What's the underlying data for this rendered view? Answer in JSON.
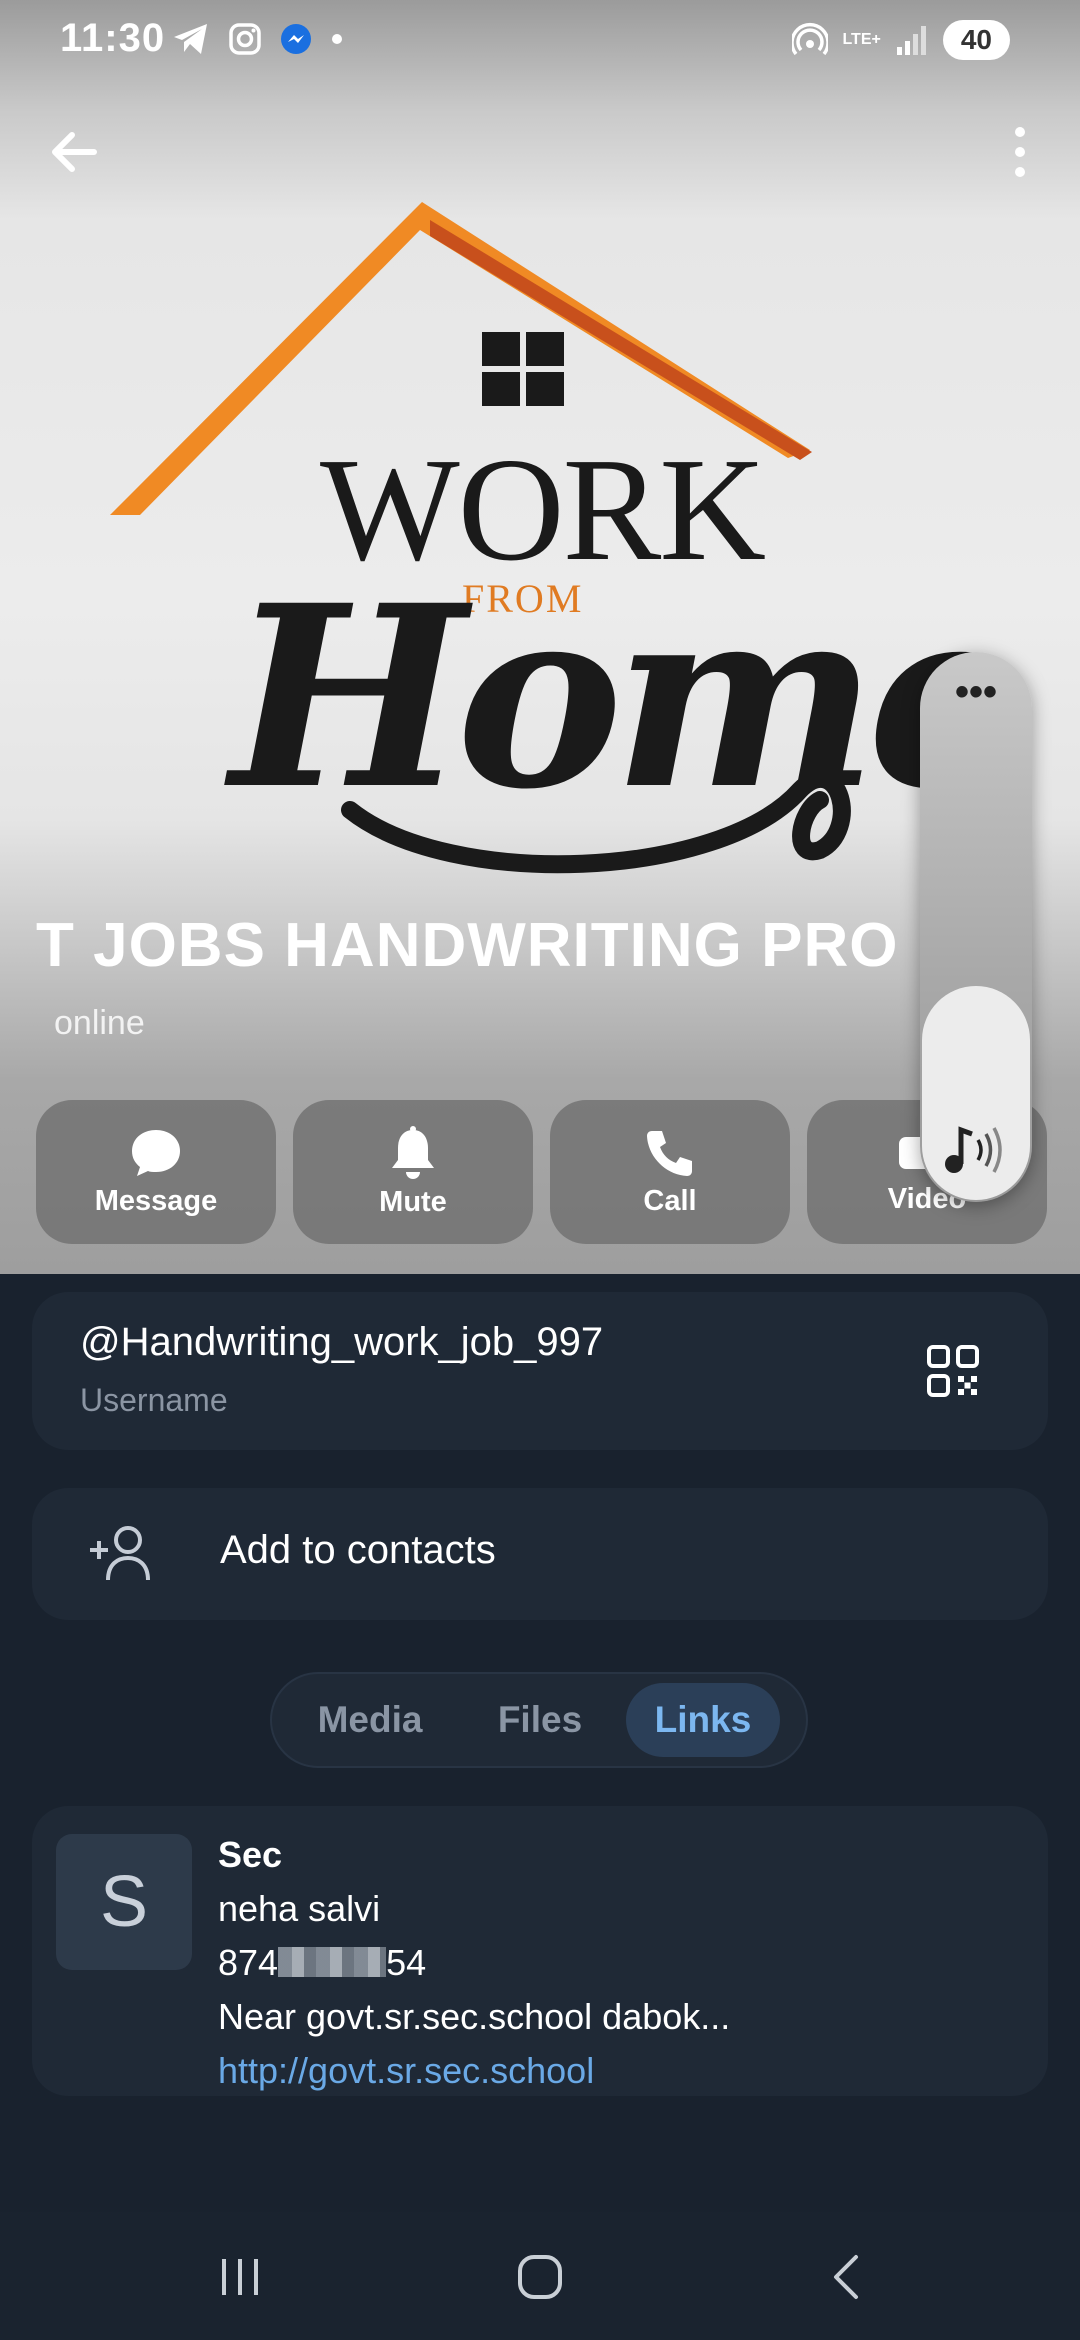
{
  "status_bar": {
    "time": "11:30",
    "network": "LTE+",
    "battery": "40",
    "icons": [
      "telegram-icon",
      "instagram-icon",
      "messenger-icon",
      "dot-icon",
      "hotspot-icon",
      "signal-icon"
    ]
  },
  "header": {
    "back_icon": "back-arrow-icon",
    "menu_icon": "more-vertical-icon"
  },
  "cover": {
    "logo_word1": "WORK",
    "logo_from": "FROM",
    "logo_word2": "Home"
  },
  "profile": {
    "name": "T JOBS    HANDWRITING PRO",
    "status": "online"
  },
  "actions": [
    {
      "label": "Message",
      "icon": "chat-bubble-icon"
    },
    {
      "label": "Mute",
      "icon": "bell-icon"
    },
    {
      "label": "Call",
      "icon": "phone-icon"
    },
    {
      "label": "Video",
      "icon": "video-camera-icon"
    }
  ],
  "volume_overlay": {
    "menu": "•••",
    "level": 0.39,
    "icon": "media-volume-icon"
  },
  "username": {
    "value": "@Handwriting_work_job_997",
    "label": "Username",
    "icon": "qr-code-icon"
  },
  "add_contact": {
    "label": "Add to contacts",
    "icon": "add-person-icon"
  },
  "tabs": {
    "items": [
      "Media",
      "Files",
      "Links"
    ],
    "active": "Links"
  },
  "link_item": {
    "thumb_letter": "S",
    "title": "Sec",
    "line1": "neha salvi",
    "line2_prefix": "874",
    "line2_suffix": "54",
    "line3": "Near govt.sr.sec.school dabok...",
    "url": "http://govt.sr.sec.school"
  },
  "nav_bar": {
    "icons": [
      "recent-apps-icon",
      "home-icon",
      "back-icon"
    ]
  },
  "colors": {
    "background": "#19222e",
    "card": "#1f2936",
    "accent": "#7cb7f0",
    "link": "#6aa9e6",
    "logo_orange": "#e07b22"
  }
}
